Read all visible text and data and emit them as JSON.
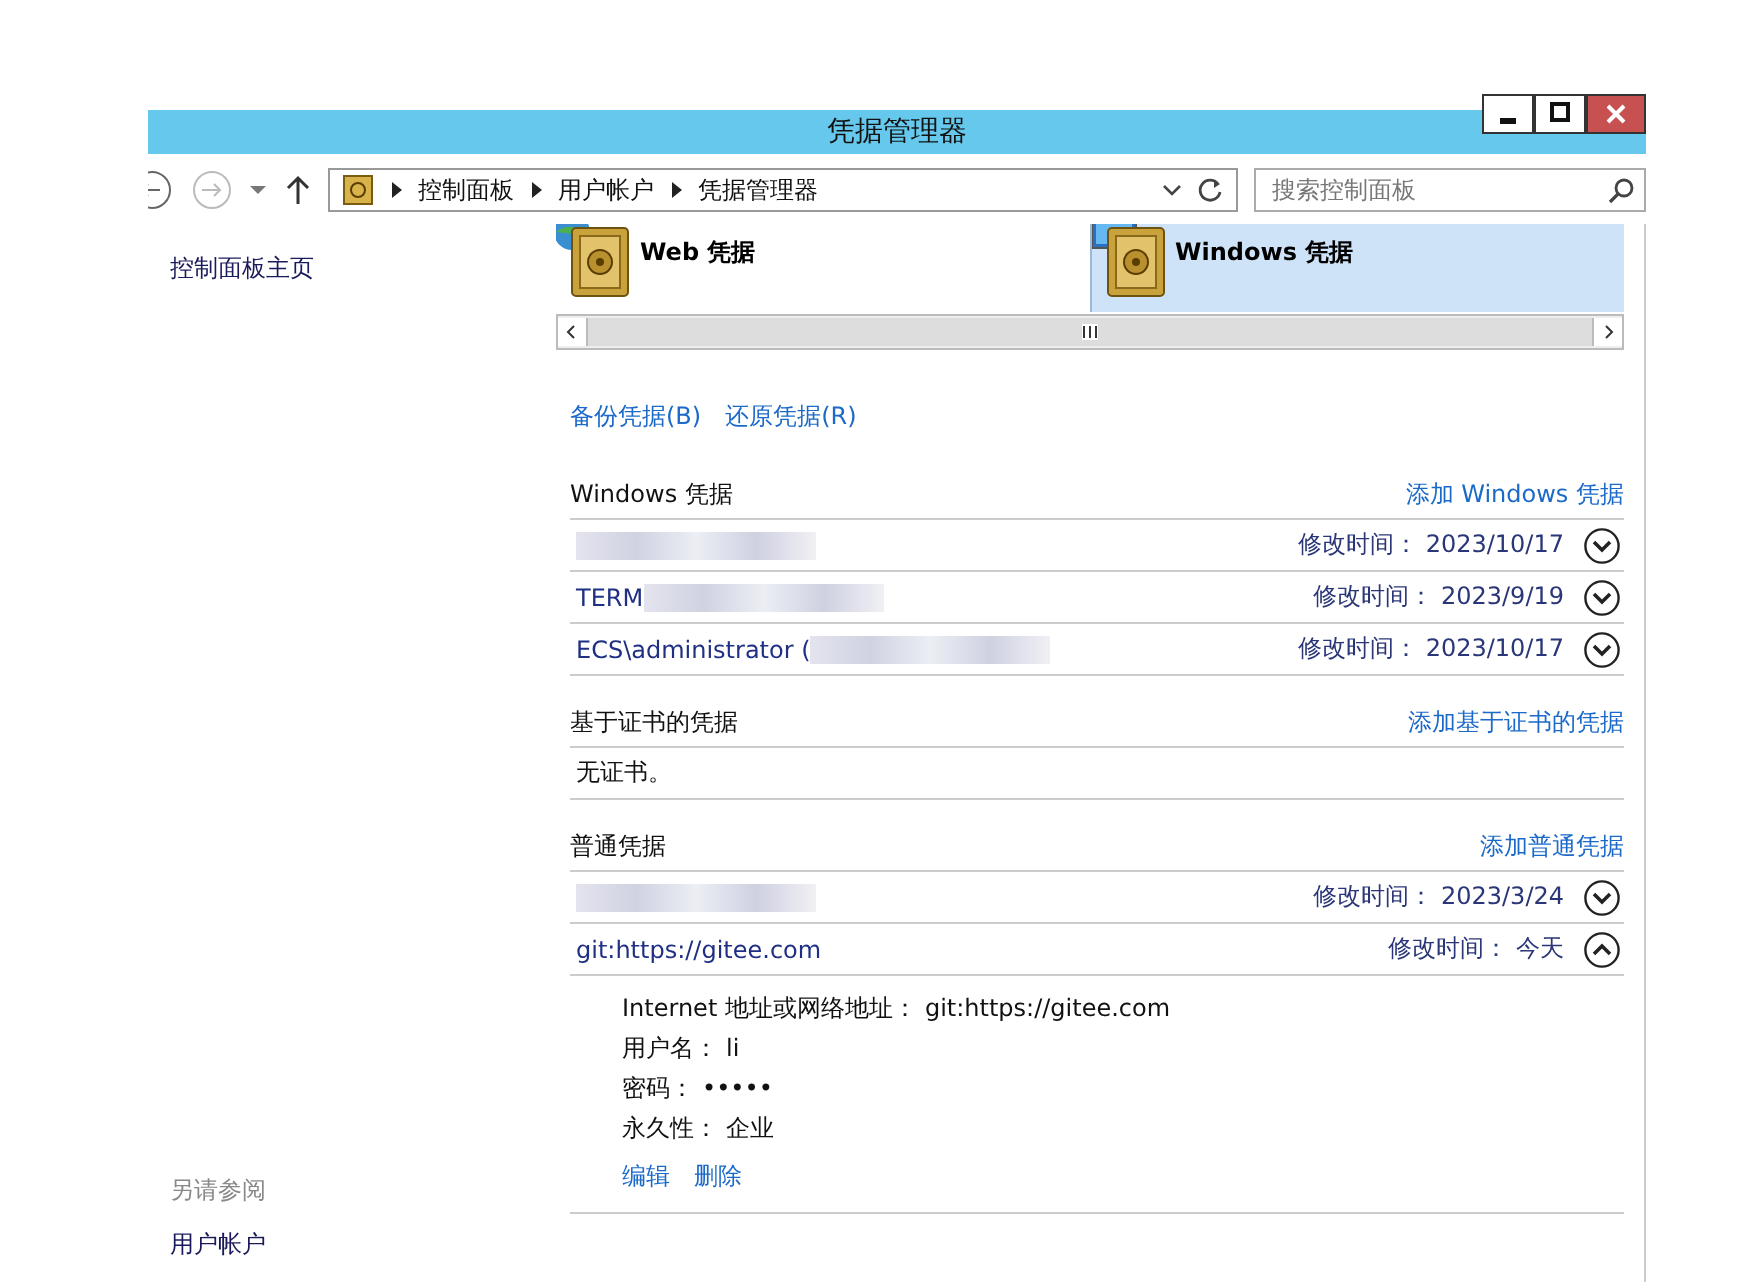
{
  "window": {
    "title": "凭据管理器"
  },
  "nav": {
    "breadcrumb": [
      "控制面板",
      "用户帐户",
      "凭据管理器"
    ],
    "search": {
      "placeholder": "搜索控制面板"
    }
  },
  "sidebar": {
    "home_link": "控制面板主页",
    "see_also_heading": "另请参阅",
    "see_also_links": [
      "用户帐户"
    ]
  },
  "tabs": [
    {
      "label": "Web 凭据",
      "kind": "web",
      "selected": false
    },
    {
      "label": "Windows 凭据",
      "kind": "windows",
      "selected": true
    }
  ],
  "actions": [
    "备份凭据(B)",
    "还原凭据(R)"
  ],
  "sections": [
    {
      "title": "Windows 凭据",
      "add_link": "添加 Windows 凭据",
      "entries": [
        {
          "redacted": true,
          "modified_label": "修改时间：",
          "modified": "2023/10/17",
          "expanded": false
        },
        {
          "name": "TERM",
          "redacted": true,
          "modified_label": "修改时间：",
          "modified": "2023/9/19",
          "expanded": false
        },
        {
          "name": "ECS\\administrator (",
          "redacted": true,
          "modified_label": "修改时间：",
          "modified": "2023/10/17",
          "expanded": false
        }
      ]
    },
    {
      "title": "基于证书的凭据",
      "add_link": "添加基于证书的凭据",
      "empty_text": "无证书。"
    },
    {
      "title": "普通凭据",
      "add_link": "添加普通凭据",
      "entries": [
        {
          "redacted": true,
          "modified_label": "修改时间：",
          "modified": "2023/3/24",
          "expanded": false
        },
        {
          "name": "git:https://gitee.com",
          "modified_label": "修改时间：",
          "modified": "今天",
          "expanded": true,
          "details": [
            {
              "label": "Internet 地址或网络地址：",
              "value": "git:https://gitee.com"
            },
            {
              "label": "用户名：",
              "value": "li"
            },
            {
              "label": "密码：",
              "value": "•••••"
            },
            {
              "label": "永久性：",
              "value": "企业"
            }
          ],
          "detail_actions": [
            "编辑",
            "删除"
          ]
        }
      ]
    }
  ]
}
